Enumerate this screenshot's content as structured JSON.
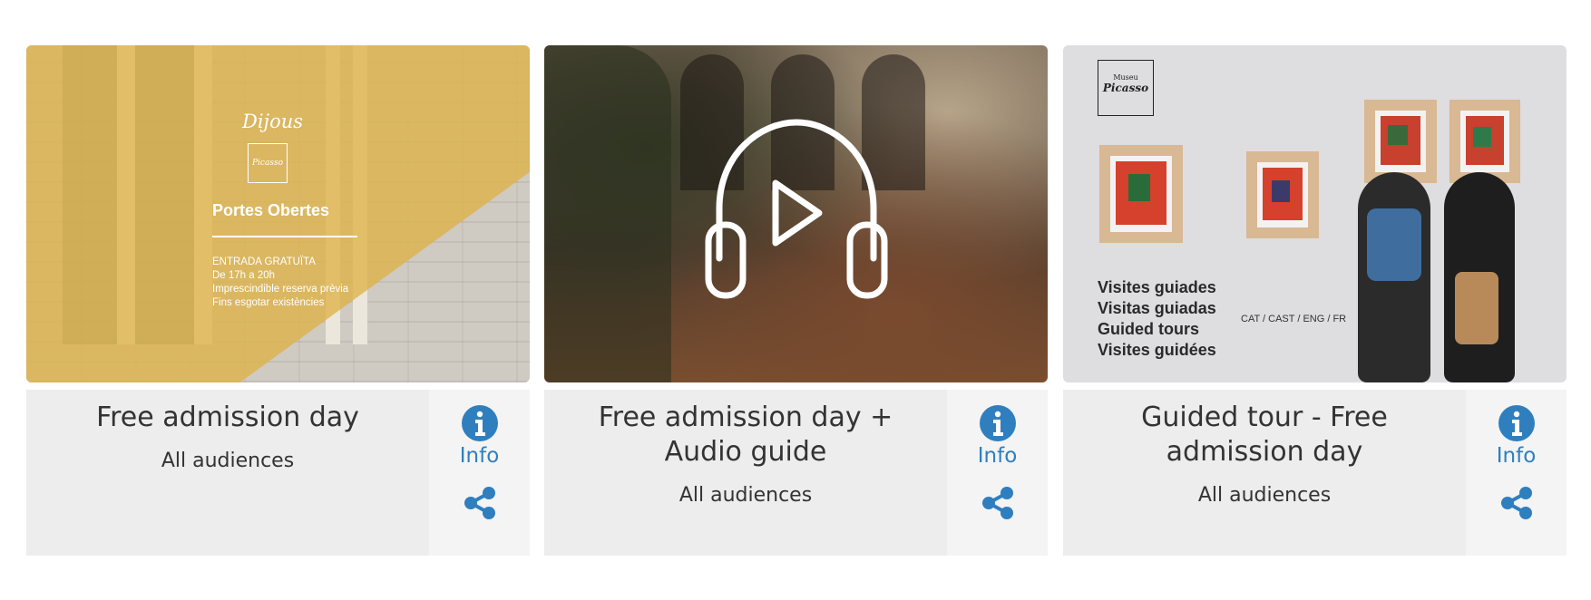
{
  "cards": [
    {
      "title": "Free admission day",
      "audience": "All audiences",
      "info_label": "Info",
      "image": {
        "heading": "Dijous",
        "logo_text": "Picasso",
        "subtitle": "Portes Obertes",
        "lines": [
          "ENTRADA GRATUÏTA",
          "De 17h a 20h",
          "Imprescindible reserva prèvia",
          "Fins esgotar existències"
        ]
      }
    },
    {
      "title": "Free admission day + Audio guide",
      "audience": "All audiences",
      "info_label": "Info",
      "image": {
        "icon": "headphones-play-icon"
      }
    },
    {
      "title": "Guided tour - Free admission day",
      "audience": "All audiences",
      "info_label": "Info",
      "image": {
        "logo_top": "Museu",
        "logo_text": "Picasso",
        "lines": [
          "Visites guiades",
          "Visitas guiadas",
          "Guided tours",
          "Visites guidées"
        ],
        "languages": "CAT / CAST / ENG / FR"
      }
    }
  ],
  "colors": {
    "accent": "#2f7fbf",
    "card_text_bg": "#ededed",
    "card_actions_bg": "#f4f4f4"
  }
}
